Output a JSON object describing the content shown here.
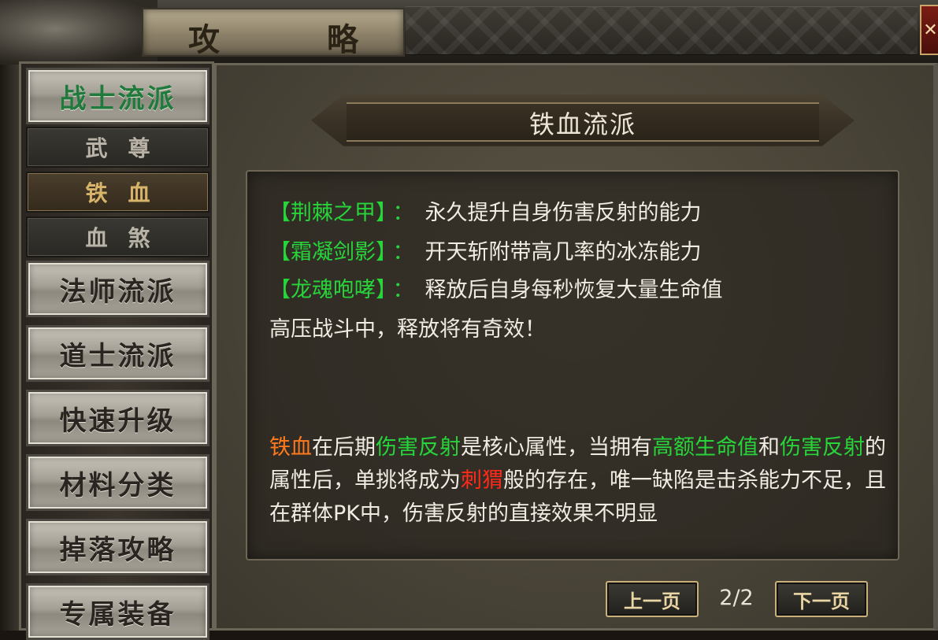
{
  "window": {
    "title": "攻　略",
    "close_label": "✕"
  },
  "sidebar": {
    "categories": [
      {
        "label": "战士流派",
        "active": true
      },
      {
        "label": "法师流派"
      },
      {
        "label": "道士流派"
      },
      {
        "label": "快速升级"
      },
      {
        "label": "材料分类"
      },
      {
        "label": "掉落攻略"
      },
      {
        "label": "专属装备"
      }
    ],
    "subitems": [
      {
        "label": "武尊"
      },
      {
        "label": "铁血",
        "selected": true
      },
      {
        "label": "血煞"
      }
    ]
  },
  "content": {
    "title": "铁血流派",
    "skills": [
      {
        "name": "【荆棘之甲】",
        "sep": "：",
        "desc": "永久提升自身伤害反射的能力"
      },
      {
        "name": "【霜凝剑影】",
        "sep": "：",
        "desc": "开天斩附带高几率的冰冻能力"
      },
      {
        "name": "【龙魂咆哮】",
        "sep": "：",
        "desc": "释放后自身每秒恢复大量生命值"
      }
    ],
    "tip": "高压战斗中，释放将有奇效！",
    "description": {
      "p1": "铁血",
      "p2": "在后期",
      "p3": "伤害反射",
      "p4": "是核心属性，当拥有",
      "p5": "高额生命值",
      "p6": "和",
      "p7": "伤害反射",
      "p8": "的属性后，单挑将成为",
      "p9": "刺猬",
      "p10": "般的存在，唯一缺陷是击杀能力不足，且在群体PK中，伤害反射的直接效果不明显"
    }
  },
  "pager": {
    "prev_label": "上一页",
    "next_label": "下一页",
    "page": "2/2"
  },
  "colors": {
    "skill_green": "#27d43a",
    "highlight_orange": "#ff7a1e",
    "highlight_red": "#ff2a1a"
  }
}
